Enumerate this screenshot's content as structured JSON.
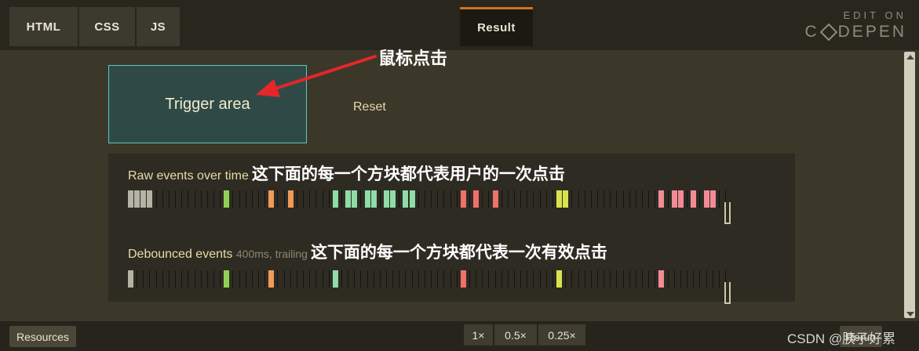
{
  "header": {
    "tabs": [
      {
        "label": "HTML"
      },
      {
        "label": "CSS"
      },
      {
        "label": "JS"
      }
    ],
    "result_tab": "Result",
    "edit_on": "EDIT ON",
    "brand_left": "C",
    "brand_right": "DEPEN"
  },
  "demo": {
    "trigger_label": "Trigger area",
    "reset_label": "Reset",
    "annotation_click": "鼠标点击",
    "raw": {
      "label": "Raw events over time",
      "annotation": "这下面的每一个方块都代表用户的一次点击"
    },
    "debounced": {
      "label": "Debounced events",
      "meta": "400ms, trailing",
      "annotation": "这下面的每一个方块都代表一次有效点击"
    },
    "colors": {
      "gray": "#b5b2a6",
      "green": "#8fd155",
      "orange": "#ef9a58",
      "mint": "#8fdca8",
      "red": "#f0706a",
      "yellow": "#d9e44b",
      "pink": "#f28b96"
    },
    "raw_events": [
      {
        "slot": 0,
        "color": "gray"
      },
      {
        "slot": 1,
        "color": "gray"
      },
      {
        "slot": 2,
        "color": "gray"
      },
      {
        "slot": 3,
        "color": "gray"
      },
      {
        "slot": 15,
        "color": "green"
      },
      {
        "slot": 22,
        "color": "orange"
      },
      {
        "slot": 25,
        "color": "orange"
      },
      {
        "slot": 32,
        "color": "mint"
      },
      {
        "slot": 34,
        "color": "mint"
      },
      {
        "slot": 35,
        "color": "mint"
      },
      {
        "slot": 37,
        "color": "mint"
      },
      {
        "slot": 38,
        "color": "mint"
      },
      {
        "slot": 40,
        "color": "mint"
      },
      {
        "slot": 41,
        "color": "mint"
      },
      {
        "slot": 43,
        "color": "mint"
      },
      {
        "slot": 44,
        "color": "mint"
      },
      {
        "slot": 52,
        "color": "red"
      },
      {
        "slot": 54,
        "color": "red"
      },
      {
        "slot": 57,
        "color": "red"
      },
      {
        "slot": 67,
        "color": "yellow"
      },
      {
        "slot": 68,
        "color": "yellow"
      },
      {
        "slot": 83,
        "color": "pink"
      },
      {
        "slot": 85,
        "color": "pink"
      },
      {
        "slot": 86,
        "color": "pink"
      },
      {
        "slot": 88,
        "color": "pink"
      },
      {
        "slot": 90,
        "color": "pink"
      },
      {
        "slot": 91,
        "color": "pink"
      }
    ],
    "debounced_events": [
      {
        "slot": 0,
        "color": "gray"
      },
      {
        "slot": 15,
        "color": "green"
      },
      {
        "slot": 22,
        "color": "orange"
      },
      {
        "slot": 32,
        "color": "mint"
      },
      {
        "slot": 52,
        "color": "red"
      },
      {
        "slot": 67,
        "color": "yellow"
      },
      {
        "slot": 83,
        "color": "pink"
      }
    ]
  },
  "footer": {
    "resources_label": "Resources",
    "zoom_levels": [
      "1×",
      "0.5×",
      "0.25×"
    ],
    "rerun_label": "Rerun",
    "watermark": "CSDN @胰子好累"
  }
}
